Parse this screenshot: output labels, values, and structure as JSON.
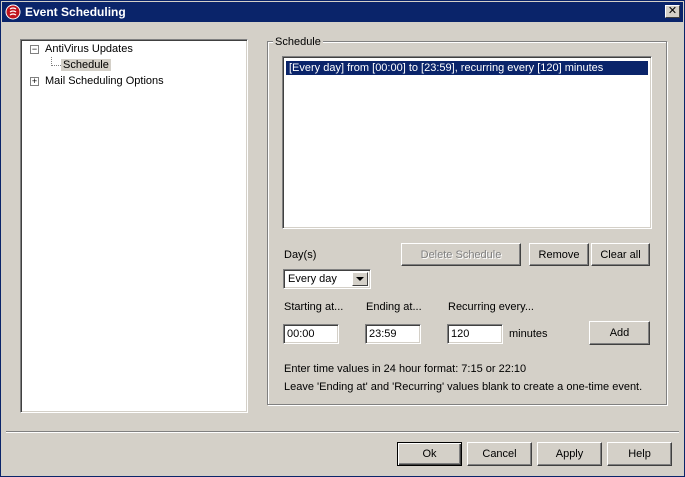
{
  "window": {
    "title": "Event Scheduling",
    "close_glyph": "✕"
  },
  "tree": {
    "items": [
      {
        "label": "AntiVirus Updates",
        "expander": "−"
      },
      {
        "label": "Schedule"
      },
      {
        "label": "Mail Scheduling Options",
        "expander": "+"
      }
    ]
  },
  "schedule": {
    "group_label": "Schedule",
    "entries": [
      "[Every day] from [00:00] to [23:59], recurring every [120] minutes"
    ],
    "days_label": "Day(s)",
    "days_value": "Every day",
    "delete_label": "Delete Schedule",
    "remove_label": "Remove",
    "clear_label": "Clear all",
    "starting_label": "Starting at...",
    "ending_label": "Ending at...",
    "recurring_label": "Recurring every...",
    "starting_value": "00:00",
    "ending_value": "23:59",
    "recurring_value": "120",
    "minutes_label": "minutes",
    "add_label": "Add",
    "hint1": "Enter time values in 24 hour format: 7:15 or 22:10",
    "hint2": "Leave 'Ending at' and 'Recurring' values blank to create a one-time event."
  },
  "footer": {
    "ok_label": "Ok",
    "cancel_label": "Cancel",
    "apply_label": "Apply",
    "help_label": "Help"
  }
}
